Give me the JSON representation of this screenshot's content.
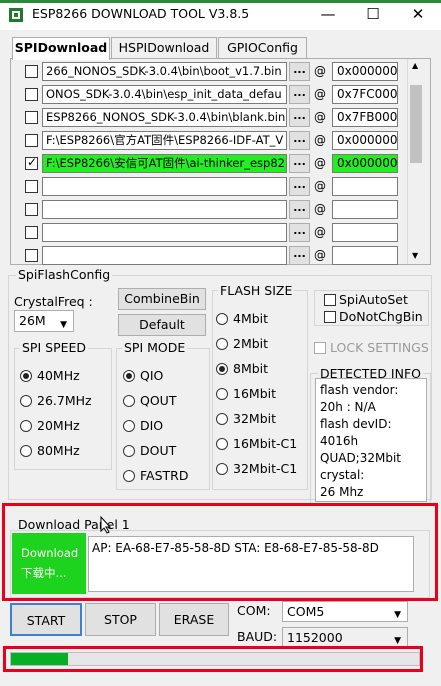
{
  "window": {
    "title": "ESP8266 DOWNLOAD TOOL V3.8.5",
    "minimize": "—",
    "maximize": "☐",
    "close": "✕"
  },
  "tabs": [
    {
      "label": "SPIDownload",
      "active": true
    },
    {
      "label": "HSPIDownload",
      "active": false
    },
    {
      "label": "GPIOConfig",
      "active": false
    }
  ],
  "files": [
    {
      "checked": false,
      "path": "266_NONOS_SDK-3.0.4\\bin\\boot_v1.7.bin",
      "btn": "...",
      "at": "@",
      "offset": "0x000000",
      "highlight": false
    },
    {
      "checked": false,
      "path": "ONOS_SDK-3.0.4\\bin\\esp_init_data_defau",
      "btn": "...",
      "at": "@",
      "offset": "0x7FC000",
      "highlight": false
    },
    {
      "checked": false,
      "path": "ESP8266_NONOS_SDK-3.0.4\\bin\\blank.bin",
      "btn": "...",
      "at": "@",
      "offset": "0x7FB000",
      "highlight": false
    },
    {
      "checked": false,
      "path": "F:\\ESP8266\\官方AT固件\\ESP8266-IDF-AT_V",
      "btn": "...",
      "at": "@",
      "offset": "0x000000",
      "highlight": false
    },
    {
      "checked": true,
      "path": "F:\\ESP8266\\安信可AT固件\\ai-thinker_esp82",
      "btn": "...",
      "at": "@",
      "offset": "0x000000",
      "highlight": true
    },
    {
      "checked": false,
      "path": "",
      "btn": "...",
      "at": "@",
      "offset": "",
      "highlight": false
    },
    {
      "checked": false,
      "path": "",
      "btn": "...",
      "at": "@",
      "offset": "",
      "highlight": false
    },
    {
      "checked": false,
      "path": "",
      "btn": "...",
      "at": "@",
      "offset": "",
      "highlight": false
    },
    {
      "checked": false,
      "path": "",
      "btn": "...",
      "at": "@",
      "offset": "",
      "highlight": false
    }
  ],
  "config": {
    "group_label": "SpiFlashConfig",
    "crystal_label": "CrystalFreq :",
    "crystal_value": "26M",
    "combine_btn": "CombineBin",
    "default_btn": "Default",
    "spi_speed": {
      "label": "SPI SPEED",
      "options": [
        "40MHz",
        "26.7MHz",
        "20MHz",
        "80MHz"
      ],
      "selected": 0
    },
    "spi_mode": {
      "label": "SPI MODE",
      "options": [
        "QIO",
        "QOUT",
        "DIO",
        "DOUT",
        "FASTRD"
      ],
      "selected": 0
    },
    "flash_size": {
      "label": "FLASH SIZE",
      "options": [
        "4Mbit",
        "2Mbit",
        "8Mbit",
        "16Mbit",
        "32Mbit",
        "16Mbit-C1",
        "32Mbit-C1"
      ],
      "selected": 2
    },
    "spi_auto_set": "SpiAutoSet",
    "do_not_chg_bin": "DoNotChgBin",
    "lock_settings": "LOCK SETTINGS",
    "detected_label": "DETECTED INFO",
    "detected_lines": [
      "flash vendor:",
      "20h : N/A",
      "flash devID:",
      "4016h",
      "QUAD;32Mbit",
      "crystal:",
      "26 Mhz"
    ]
  },
  "download": {
    "panel_label": "Download Panel 1",
    "status_line1": "Download",
    "status_line2": "下载中...",
    "mac_text": "AP:  EA-68-E7-85-58-8D  STA:  E8-68-E7-85-58-8D"
  },
  "controls": {
    "start": "START",
    "stop": "STOP",
    "erase": "ERASE",
    "com_label": "COM:",
    "com_value": "COM5",
    "baud_label": "BAUD:",
    "baud_value": "1152000"
  },
  "progress": {
    "fraction": 0.14
  },
  "colors": {
    "accent_green": "#22ee22",
    "status_green": "#1ed31e",
    "highlight_red": "#e8001c",
    "progress_green": "#06b025"
  }
}
